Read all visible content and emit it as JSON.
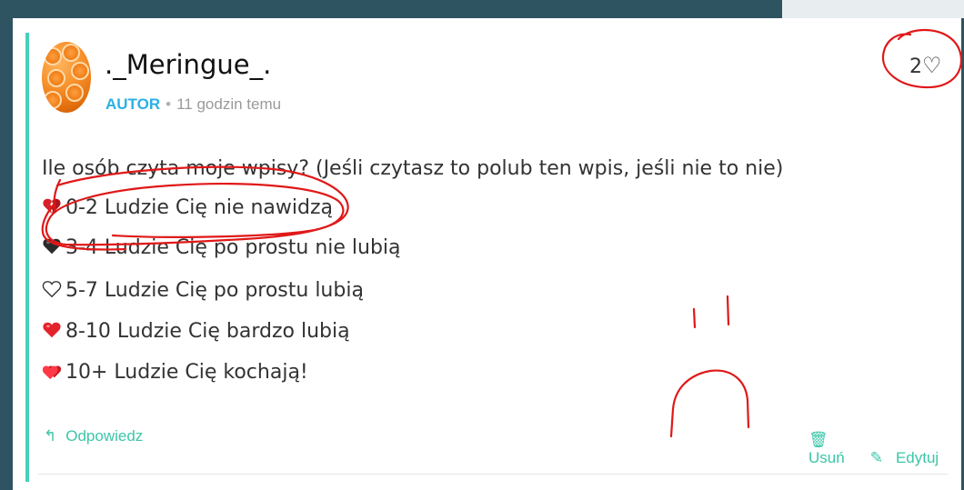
{
  "post": {
    "author": "._Meringue_.",
    "role_badge": "AUTOR",
    "separator": "•",
    "time": "11 godzin temu",
    "likes": {
      "count": "2",
      "icon": "heart-outline-icon"
    },
    "lines": [
      {
        "text": "Ile osób czyta moje wpisy? (Jeśli czytasz to polub ten wpis, jeśli nie to nie)"
      },
      {
        "icon": "broken-heart-icon",
        "text": "0-2 Ludzie Cię nie nawidzą"
      },
      {
        "icon": "black-heart-icon",
        "text": "3-4 Ludzie Cię po prostu nie lubią"
      },
      {
        "icon": "white-heart-icon",
        "text": "5-7 Ludzie Cię po prostu lubią"
      },
      {
        "icon": "red-heart-icon",
        "text": "8-10 Ludzie Cię bardzo lubią"
      },
      {
        "icon": "hearts-icon",
        "text": "10+ Ludzie Cię kochają!"
      }
    ]
  },
  "actions": {
    "reply": "Odpowiedz",
    "delete": "Usuń",
    "edit": "Edytuj"
  },
  "colors": {
    "accent": "#45d1b8",
    "badge": "#2ab0e4",
    "action": "#3cc6a9",
    "annotation": "#e01818"
  }
}
